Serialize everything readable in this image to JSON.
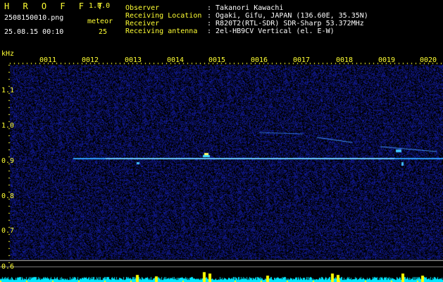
{
  "app": {
    "logo": "H R O F F T",
    "version": "1.0.0"
  },
  "capture": {
    "filename": "2508150010.png",
    "datetime": "25.08.15 00:10",
    "meteor_label": "meteor",
    "meteor_count": "25"
  },
  "info": {
    "labels": [
      "Observer",
      "Receiving Location",
      "Receiver",
      "Receiving antenna"
    ],
    "values": [
      ": Takanori Kawachi",
      ": Ogaki, Gifu, JAPAN (136.60E, 35.35N)",
      ": R820T2(RTL-SDR) SDR-Sharp 53.372MHz",
      ": 2el-HB9CV Vertical (el. E-W)"
    ]
  },
  "axis": {
    "y_unit": "kHz",
    "y_ticks": [
      "1.1",
      "1.0",
      "0.9",
      "0.8",
      "0.7",
      "0.6"
    ],
    "x_ticks": [
      "0011",
      "0012",
      "0013",
      "0014",
      "0015",
      "0016",
      "0017",
      "0018",
      "0019",
      "0020"
    ]
  },
  "colors": {
    "text_yellow": "#ffff33",
    "text_white": "#ffffff",
    "background": "#000000",
    "noise_blue": "#1020a0",
    "signal_cyan": "#00ffff",
    "activity_yellow": "#ffff00"
  }
}
